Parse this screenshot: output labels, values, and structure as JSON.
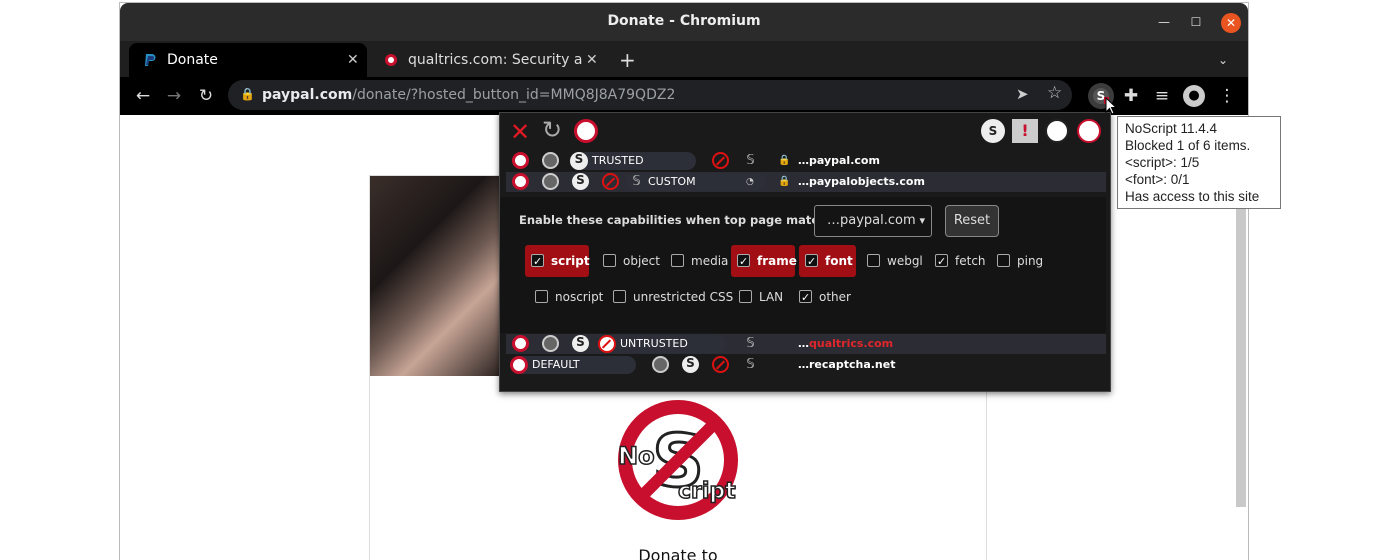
{
  "window": {
    "title": "Donate - Chromium"
  },
  "tabs": [
    {
      "label": "Donate",
      "active": true
    },
    {
      "label": "qualtrics.com: Security an",
      "active": false
    }
  ],
  "toolbar": {
    "url_host": "paypal.com",
    "url_path": "/donate/?hosted_button_id=MMQ8J8A79QDZ2"
  },
  "page": {
    "donate_label": "Donate to"
  },
  "noscript": {
    "presets": {
      "trusted": "TRUSTED",
      "custom": "CUSTOM",
      "untrusted": "UNTRUSTED",
      "default": "DEFAULT"
    },
    "sites": [
      {
        "prefix": "…",
        "host": "paypal.com",
        "preset": "TRUSTED"
      },
      {
        "prefix": "…",
        "host": "paypalobjects.com",
        "preset": "CUSTOM"
      },
      {
        "prefix": "…",
        "host": "qualtrics.com",
        "preset": "UNTRUSTED"
      },
      {
        "prefix": "…",
        "host": "recaptcha.net",
        "preset": "DEFAULT"
      }
    ],
    "capabilities_label": "Enable these capabilities when top page matches",
    "match_select_value": "…paypal.com",
    "reset_label": "Reset",
    "capabilities": [
      {
        "name": "script",
        "checked": true,
        "highlight": true
      },
      {
        "name": "object",
        "checked": false,
        "highlight": false
      },
      {
        "name": "media",
        "checked": false,
        "highlight": false
      },
      {
        "name": "frame",
        "checked": true,
        "highlight": true
      },
      {
        "name": "font",
        "checked": true,
        "highlight": true
      },
      {
        "name": "webgl",
        "checked": false,
        "highlight": false
      },
      {
        "name": "fetch",
        "checked": true,
        "highlight": false
      },
      {
        "name": "ping",
        "checked": false,
        "highlight": false
      },
      {
        "name": "noscript",
        "checked": false,
        "highlight": false
      },
      {
        "name": "unrestricted CSS",
        "checked": false,
        "highlight": false
      },
      {
        "name": "LAN",
        "checked": false,
        "highlight": false
      },
      {
        "name": "other",
        "checked": true,
        "highlight": false
      }
    ]
  },
  "tooltip": {
    "lines": [
      "NoScript 11.4.4",
      "Blocked 1 of 6 items.",
      "<script>: 1/5",
      "<font>: 0/1",
      "Has access to this site"
    ]
  },
  "colors": {
    "accent_red": "#c8102e",
    "untrusted_host": "#e0262b",
    "close_button": "#e95420"
  }
}
